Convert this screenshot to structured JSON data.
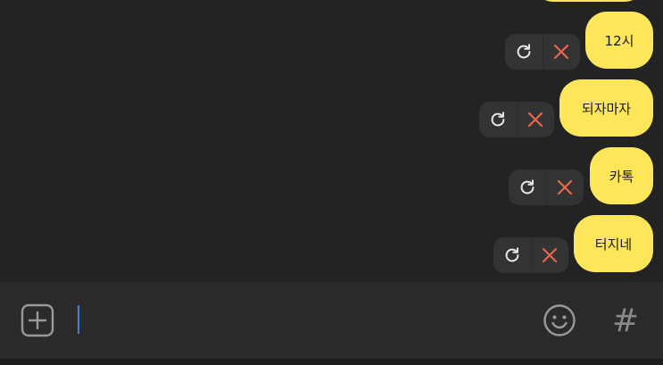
{
  "messages": [
    {
      "text": "12시"
    },
    {
      "text": "되자마자"
    },
    {
      "text": "카톡"
    },
    {
      "text": "터지네"
    }
  ],
  "controls": {
    "retry_icon": "retry-icon",
    "cancel_icon": "close-icon"
  },
  "composer": {
    "attach_icon": "plus-square-icon",
    "emoji_icon": "smiley-icon",
    "hashtag_label": "#",
    "input_value": ""
  },
  "colors": {
    "bubble": "#fde65a",
    "chat_bg": "#232323",
    "composer_bg": "#2b2b2b",
    "control_bg": "#333333",
    "cancel_x": "#e8674e",
    "caret": "#4a7fd6"
  }
}
